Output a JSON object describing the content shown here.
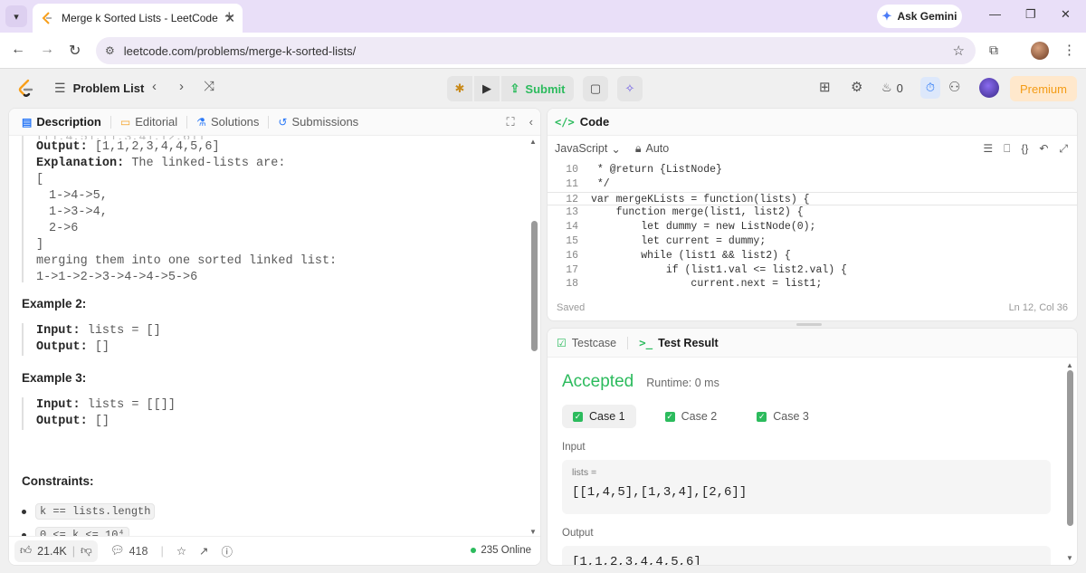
{
  "browser": {
    "tab_title": "Merge k Sorted Lists - LeetCode",
    "new_tab_label": "+",
    "ask_gemini_label": "Ask Gemini",
    "url": "leetcode.com/problems/merge-k-sorted-lists/"
  },
  "header": {
    "problem_list_label": "Problem List",
    "submit_label": "Submit",
    "streak_count": "0",
    "premium_label": "Premium"
  },
  "left_panel": {
    "tabs": [
      {
        "label": "Description",
        "active": true,
        "icon": "description-icon"
      },
      {
        "label": "Editorial",
        "active": false,
        "icon": "editorial-icon"
      },
      {
        "label": "Solutions",
        "active": false,
        "icon": "solutions-icon"
      },
      {
        "label": "Submissions",
        "active": false,
        "icon": "submissions-icon"
      }
    ],
    "example1": {
      "output_label": "Output:",
      "output_value": "[1,1,2,3,4,4,5,6]",
      "explanation_label": "Explanation:",
      "explanation_text": "The linked-lists are:",
      "open_bracket": "[",
      "list1": "1->4->5,",
      "list2": "1->3->4,",
      "list3": "2->6",
      "close_bracket": "]",
      "merge_text": "merging them into one sorted linked list:",
      "merged": "1->1->2->3->4->4->5->6"
    },
    "example2": {
      "heading": "Example 2:",
      "input_label": "Input:",
      "input_value": "lists = []",
      "output_label": "Output:",
      "output_value": "[]"
    },
    "example3": {
      "heading": "Example 3:",
      "input_label": "Input:",
      "input_value": "lists = [[]]",
      "output_label": "Output:",
      "output_value": "[]"
    },
    "constraints_heading": "Constraints:",
    "constraints": [
      "k == lists.length",
      "0 <= k <= 10⁴"
    ],
    "footer": {
      "likes": "21.4K",
      "comments": "418",
      "online": "235 Online"
    }
  },
  "code_panel": {
    "title": "Code",
    "language": "JavaScript",
    "mode": "Auto",
    "status_left": "Saved",
    "status_right": "Ln 12, Col 36",
    "lines": [
      {
        "n": "10",
        "text": " * @return {ListNode}"
      },
      {
        "n": "11",
        "text": " */"
      },
      {
        "n": "12",
        "text": "var mergeKLists = function(lists) {"
      },
      {
        "n": "13",
        "text": "    function merge(list1, list2) {"
      },
      {
        "n": "14",
        "text": "        let dummy = new ListNode(0);"
      },
      {
        "n": "15",
        "text": "        let current = dummy;"
      },
      {
        "n": "16",
        "text": "        while (list1 && list2) {"
      },
      {
        "n": "17",
        "text": "            if (list1.val <= list2.val) {"
      },
      {
        "n": "18",
        "text": "                current.next = list1;"
      }
    ]
  },
  "result_panel": {
    "testcase_tab": "Testcase",
    "result_tab": "Test Result",
    "status": "Accepted",
    "runtime": "Runtime: 0 ms",
    "cases": [
      "Case 1",
      "Case 2",
      "Case 3"
    ],
    "input_label": "Input",
    "input_var": "lists =",
    "input_value": "[[1,4,5],[1,3,4],[2,6]]",
    "output_label": "Output",
    "output_value": "[1,1,2,3,4,4,5,6]"
  }
}
